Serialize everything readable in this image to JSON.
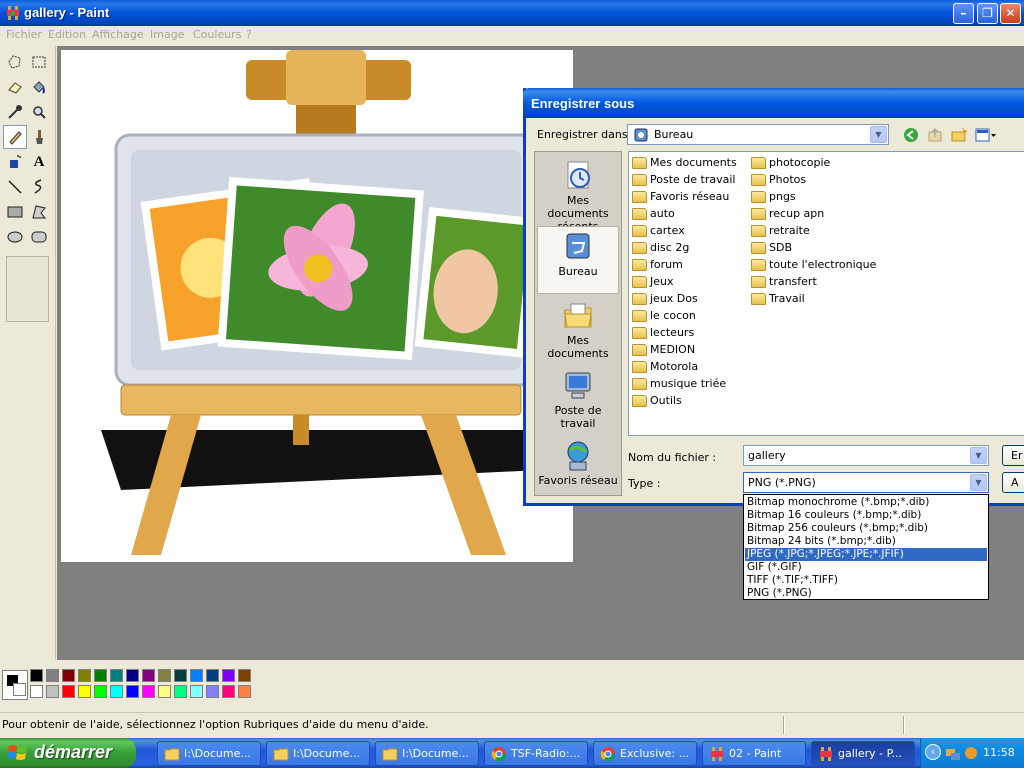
{
  "window": {
    "title": "gallery - Paint",
    "minimize_glyph": "–",
    "maximize_glyph": "❐",
    "close_glyph": "✕"
  },
  "menu": [
    "Fichier",
    "Edition",
    "Affichage",
    "Image",
    "Couleurs",
    "?"
  ],
  "tools": [
    "free-select-icon",
    "rect-select-icon",
    "eraser-icon",
    "fill-icon",
    "color-picker-icon",
    "magnifier-icon",
    "pencil-icon",
    "brush-icon",
    "airbrush-icon",
    "text-icon",
    "line-icon",
    "curve-icon",
    "rectangle-icon",
    "polygon-icon",
    "ellipse-icon",
    "rounded-rect-icon"
  ],
  "text_tool_glyph": "A",
  "colors": {
    "accent": "#316ac5",
    "palette_top": [
      "#000000",
      "#808080",
      "#800000",
      "#808000",
      "#008000",
      "#008080",
      "#000080",
      "#800080",
      "#808040",
      "#004040",
      "#0080ff",
      "#004080",
      "#8000ff",
      "#804000"
    ],
    "palette_bottom": [
      "#ffffff",
      "#c0c0c0",
      "#ff0000",
      "#ffff00",
      "#00ff00",
      "#00ffff",
      "#0000ff",
      "#ff00ff",
      "#ffff80",
      "#00ff80",
      "#80ffff",
      "#8080ff",
      "#ff0080",
      "#ff8040"
    ]
  },
  "status": {
    "message": "Pour obtenir de l'aide, sélectionnez l'option Rubriques d'aide du menu d'aide."
  },
  "taskbar": {
    "start_label": "démarrer",
    "tasks": [
      {
        "label": "I:\\Docume...",
        "icon": "folder-icon"
      },
      {
        "label": "I:\\Docume...",
        "icon": "folder-icon"
      },
      {
        "label": "I:\\Docume...",
        "icon": "folder-icon"
      },
      {
        "label": "TSF-Radio:...",
        "icon": "chrome-icon"
      },
      {
        "label": "Exclusive: ...",
        "icon": "chrome-icon"
      },
      {
        "label": "02 - Paint",
        "icon": "paint-icon"
      },
      {
        "label": "gallery - P...",
        "icon": "paint-icon"
      }
    ],
    "tray_arrow": "‹",
    "clock": "11:58"
  },
  "dialog": {
    "title": "Enregistrer sous",
    "save_in_label": "Enregistrer dans :",
    "save_in_value": "Bureau",
    "places": [
      "Mes documents récents",
      "Bureau",
      "Mes documents",
      "Poste de travail",
      "Favoris réseau"
    ],
    "files_col1": [
      "Mes documents",
      "Poste de travail",
      "Favoris réseau",
      "auto",
      "cartex",
      "disc 2g",
      "forum",
      "Jeux",
      "jeux Dos",
      "le cocon",
      "lecteurs",
      "MEDION",
      "Motorola",
      "musique triée",
      "Outils"
    ],
    "files_col2": [
      "photocopie",
      "Photos",
      "pngs",
      "recup apn",
      "retraite",
      "SDB",
      "toute l'electronique",
      "transfert",
      "Travail"
    ],
    "filename_label": "Nom du fichier :",
    "filename_value": "gallery",
    "type_label": "Type :",
    "type_value": "PNG (*.PNG)",
    "save_button": "Er",
    "cancel_button": "A",
    "type_options": [
      "Bitmap monochrome (*.bmp;*.dib)",
      "Bitmap 16 couleurs (*.bmp;*.dib)",
      "Bitmap 256 couleurs (*.bmp;*.dib)",
      "Bitmap 24 bits (*.bmp;*.dib)",
      "JPEG (*.JPG;*.JPEG;*.JPE;*.JFIF)",
      "GIF (*.GIF)",
      "TIFF (*.TIF;*.TIFF)",
      "PNG (*.PNG)"
    ],
    "type_selected_index": 4
  }
}
